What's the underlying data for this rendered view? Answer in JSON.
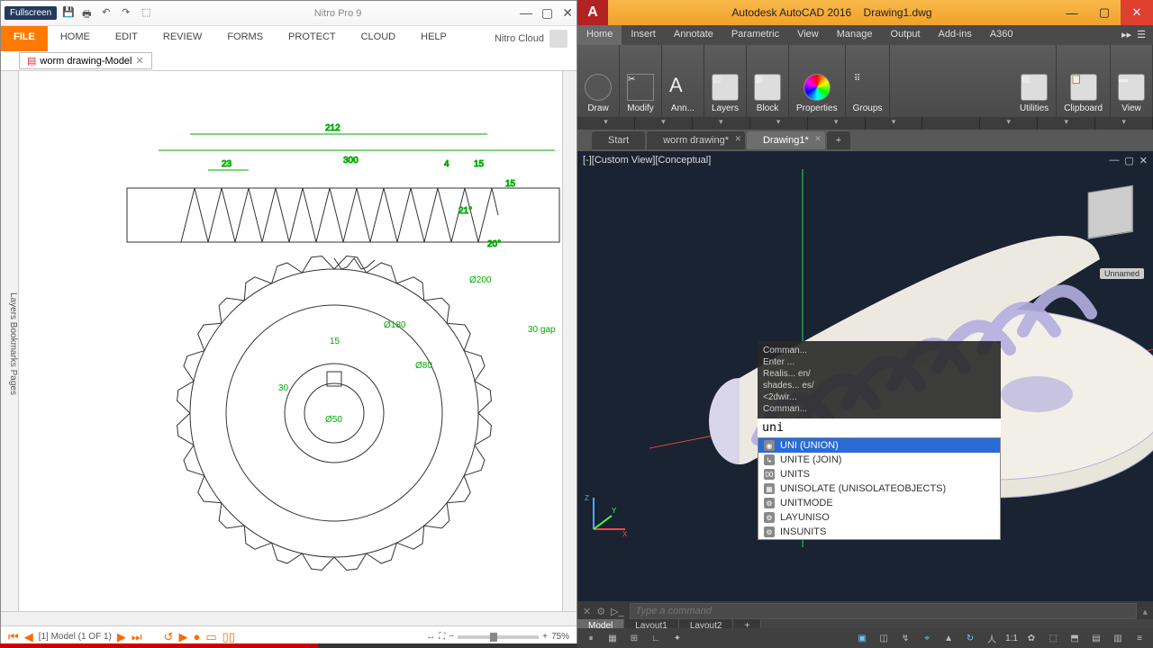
{
  "nitro": {
    "fullscreen_badge": "Fullscreen",
    "title": "Nitro Pro 9",
    "cloud_label": "Nitro Cloud",
    "ribbon": [
      "FILE",
      "HOME",
      "EDIT",
      "REVIEW",
      "FORMS",
      "PROTECT",
      "CLOUD",
      "HELP"
    ],
    "doc_tab": "worm drawing-Model",
    "sidebar_labels": "Layers  Bookmarks  Pages",
    "status": {
      "page_label": "[1] Model (1 OF 1)",
      "zoom_pct": "75%"
    },
    "drawing_dims": {
      "w_top1": "212",
      "w_top2": "300",
      "pitch": "23",
      "tooth_w": "4",
      "tooth_h": "15",
      "shaft_h": "30",
      "tooth_ext": "15",
      "angle1": "21°",
      "angle2": "20°",
      "d_outer": "Ø200",
      "d_mid": "Ø180",
      "d_hub": "Ø80",
      "d_bore": "Ø50",
      "key_w": "15",
      "key_h": "30",
      "gap": "30 gap"
    }
  },
  "acad": {
    "title_app": "Autodesk AutoCAD 2016",
    "title_file": "Drawing1.dwg",
    "ribbon_tabs": [
      "Home",
      "Insert",
      "Annotate",
      "Parametric",
      "View",
      "Manage",
      "Output",
      "Add-ins",
      "A360"
    ],
    "panels": [
      "Draw",
      "Modify",
      "Ann...",
      "Layers",
      "Block",
      "Properties",
      "Groups",
      "Utilities",
      "Clipboard",
      "View"
    ],
    "file_tabs": [
      {
        "label": "Start",
        "active": false,
        "dirty": false
      },
      {
        "label": "worm drawing",
        "active": false,
        "dirty": true
      },
      {
        "label": "Drawing1",
        "active": true,
        "dirty": true
      }
    ],
    "viewport_label": "[-][Custom View][Conceptual]",
    "viewcube_note": "Unnamed",
    "command_history": [
      "Comman...",
      "Enter ...",
      "Realis...                                       en/",
      "shades...                                       es/",
      "<2dwir...",
      "Comman..."
    ],
    "command_input": "uni",
    "autocomplete": [
      "UNI (UNION)",
      "UNITE (JOIN)",
      "UNITS",
      "UNISOLATE (UNISOLATEOBJECTS)",
      "UNITMODE",
      "LAYUNISO",
      "INSUNITS"
    ],
    "cmdbar_placeholder": "Type a command",
    "model_tabs": [
      "Model",
      "Layout1",
      "Layout2"
    ],
    "status_coords": "",
    "scale": "1:1"
  }
}
